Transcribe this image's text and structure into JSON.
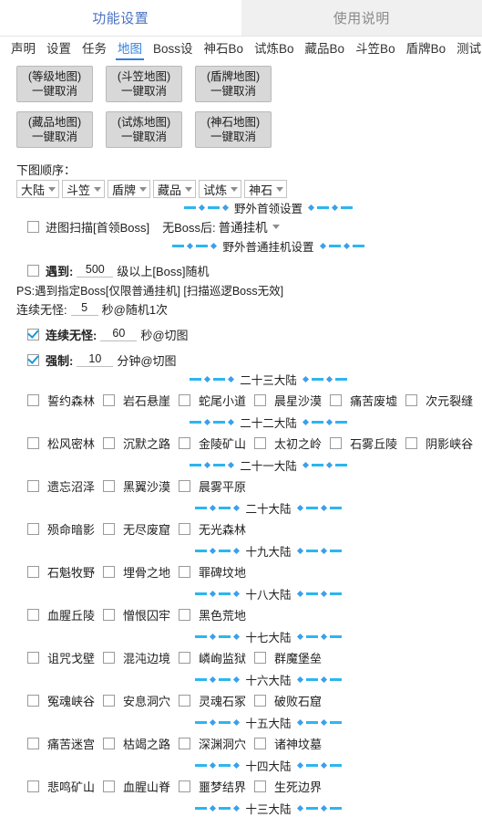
{
  "main_tabs": [
    {
      "label": "功能设置",
      "active": true
    },
    {
      "label": "使用说明",
      "active": false
    }
  ],
  "sub_tabs": [
    {
      "label": "声明",
      "active": false
    },
    {
      "label": "设置",
      "active": false
    },
    {
      "label": "任务",
      "active": false
    },
    {
      "label": "地图",
      "active": true
    },
    {
      "label": "Boss设",
      "active": false
    },
    {
      "label": "神石Bo",
      "active": false
    },
    {
      "label": "试炼Bo",
      "active": false
    },
    {
      "label": "藏品Bo",
      "active": false
    },
    {
      "label": "斗笠Bo",
      "active": false
    },
    {
      "label": "盾牌Bo",
      "active": false
    },
    {
      "label": "测试",
      "active": false
    }
  ],
  "cancel_buttons": [
    [
      {
        "line1": "(等级地图)",
        "line2": "一键取消"
      },
      {
        "line1": "(斗笠地图)",
        "line2": "一键取消"
      },
      {
        "line1": "(盾牌地图)",
        "line2": "一键取消"
      }
    ],
    [
      {
        "line1": "(藏品地图)",
        "line2": "一键取消"
      },
      {
        "line1": "(试炼地图)",
        "line2": "一键取消"
      },
      {
        "line1": "(神石地图)",
        "line2": "一键取消"
      }
    ]
  ],
  "order": {
    "label": "下图顺序：",
    "selects": [
      "大陆",
      "斗笠",
      "盾牌",
      "藏品",
      "试炼",
      "神石"
    ]
  },
  "dividers": {
    "boss_setting": "野外首领设置",
    "normal_hang": "野外普通挂机设置"
  },
  "boss_scan": {
    "checked": false,
    "label": "进图扫描[首领Boss]",
    "after_label": "无Boss后:",
    "mode": "普通挂机"
  },
  "encounter": {
    "checked": false,
    "prefix": "遇到:",
    "value": "500",
    "suffix": "级以上[Boss]随机"
  },
  "ps_note": "PS:遇到指定Boss[仅限普通挂机]  [扫描巡逻Boss无效]",
  "no_monster_random": {
    "prefix": "连续无怪:",
    "value": "5",
    "suffix": "秒@随机1次"
  },
  "no_monster_switch": {
    "checked": true,
    "prefix": "连续无怪:",
    "value": "60",
    "suffix": "秒@切图"
  },
  "force_switch": {
    "checked": true,
    "prefix": "强制:",
    "value": "10",
    "suffix": "分钟@切图"
  },
  "continents": [
    {
      "title": "二十三大陆",
      "maps": [
        "誓约森林",
        "岩石悬崖",
        "蛇尾小道",
        "晨星沙漠",
        "痛苦废墟",
        "次元裂缝"
      ]
    },
    {
      "title": "二十二大陆",
      "maps": [
        "松风密林",
        "沉默之路",
        "金陵矿山",
        "太初之岭",
        "石雾丘陵",
        "阴影峡谷"
      ]
    },
    {
      "title": "二十一大陆",
      "maps": [
        "遗忘沼泽",
        "黑翼沙漠",
        "晨雾平原"
      ]
    },
    {
      "title": "二十大陆",
      "maps": [
        "殒命暗影",
        "无尽废窟",
        "无光森林"
      ]
    },
    {
      "title": "十九大陆",
      "maps": [
        "石魁牧野",
        "埋骨之地",
        "罪碑坟地"
      ]
    },
    {
      "title": "十八大陆",
      "maps": [
        "血腥丘陵",
        "憎恨囚牢",
        "黑色荒地"
      ]
    },
    {
      "title": "十七大陆",
      "maps": [
        "诅咒戈壁",
        "混沌边境",
        "嶙峋监狱",
        "群魔堡垒"
      ]
    },
    {
      "title": "十六大陆",
      "maps": [
        "冤魂峡谷",
        "安息洞穴",
        "灵魂石冢",
        "破败石窟"
      ]
    },
    {
      "title": "十五大陆",
      "maps": [
        "痛苦迷宫",
        "枯竭之路",
        "深渊洞穴",
        "诸神坟墓"
      ]
    },
    {
      "title": "十四大陆",
      "maps": [
        "悲鸣矿山",
        "血腥山脊",
        "噩梦结界",
        "生死边界"
      ]
    },
    {
      "title": "十三大陆",
      "maps": []
    }
  ],
  "colors": {
    "accent_blue": "#2f7fe0",
    "main_tab_active": "#4a72c4",
    "divider_dash": "#2cb6f0",
    "divider_diamond": "#3aa0ea",
    "check_mark": "#1a9ad6",
    "button_bg": "#d8d8d8"
  }
}
